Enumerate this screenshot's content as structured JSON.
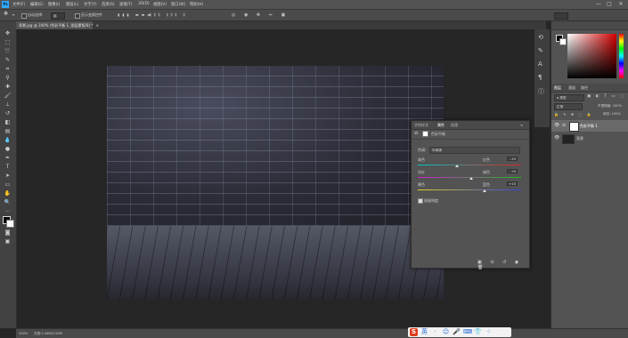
{
  "menubar": {
    "items": [
      "文件(F)",
      "编辑(E)",
      "图像(I)",
      "图层(L)",
      "文字(Y)",
      "选择(S)",
      "滤镜(T)",
      "3D(D)",
      "视图(V)",
      "窗口(W)",
      "帮助(H)"
    ],
    "window_controls": [
      "—",
      "□",
      "✕"
    ]
  },
  "optionsbar": {
    "auto_select_label": "自动选择:",
    "auto_select_value": "组",
    "show_transform_label": "显示变换控件"
  },
  "document_tab": {
    "label": "背景.jpg @ 100% (色彩平衡 1, 图层蒙版/8) *"
  },
  "properties": {
    "tabs": [
      "字符样式",
      "属性",
      "段落"
    ],
    "adjustment_title": "色彩平衡",
    "tone_label": "色调:",
    "tone_value": "中间调",
    "sliders": [
      {
        "left": "青色",
        "right": "红色",
        "value": "-15",
        "position": 0.38
      },
      {
        "left": "洋红",
        "right": "绿色",
        "value": "+5",
        "position": 0.52
      },
      {
        "left": "黄色",
        "right": "蓝色",
        "value": "+15",
        "position": 0.65
      }
    ],
    "preserve_luminosity_label": "保留明度"
  },
  "layers": {
    "tabs": [
      "图层",
      "通道",
      "路径"
    ],
    "filter_label": "ρ 类型",
    "blend_mode": "正常",
    "opacity_label": "不透明度: 100%",
    "fill_label": "填充: 100%",
    "rows": [
      {
        "name": "色彩平衡 1",
        "selected": true
      },
      {
        "name": "背景",
        "selected": false
      }
    ]
  },
  "statusbar": {
    "zoom": "100%",
    "doc_info": "文档:2.54M/2.54M"
  },
  "ime": {
    "icons": [
      "S",
      "英",
      "·",
      "☺",
      "🎤",
      "⌨",
      "👕",
      "⁘"
    ]
  },
  "colors": {
    "fg_swatch": "#000000",
    "bg_swatch": "#ffffff",
    "accent_red": "#d40000"
  }
}
